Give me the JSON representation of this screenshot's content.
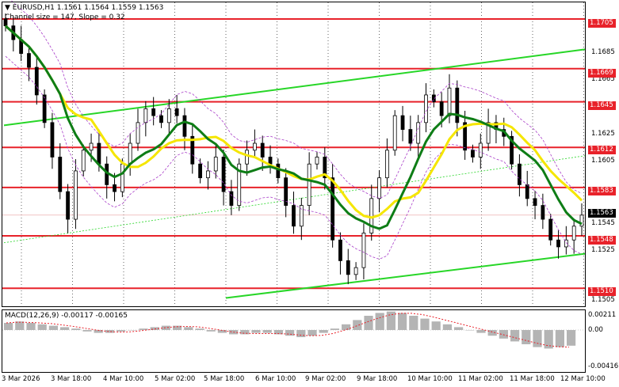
{
  "chart_header": {
    "symbol_info": "EURUSD,H1  1.1561 1.1564 1.1559 1.1563",
    "channel_info": "Channel size = 147, Slope = 0.32"
  },
  "price_levels": [
    {
      "label": "1.1705",
      "price": 1.1705
    },
    {
      "label": "1.1669",
      "price": 1.1669
    },
    {
      "label": "1.1645",
      "price": 1.1645
    },
    {
      "label": "1.1612",
      "price": 1.1612
    },
    {
      "label": "1.1583",
      "price": 1.1583
    },
    {
      "label": "1.1548",
      "price": 1.1548
    },
    {
      "label": "1.1510",
      "price": 1.151
    }
  ],
  "current_price": {
    "label": "1.1563",
    "price": 1.1563
  },
  "price_axis_ticks": [
    "1.1685",
    "1.1665",
    "1.1625",
    "1.1605",
    "1.1545",
    "1.1525",
    "1.1505"
  ],
  "time_axis": [
    "3 Mar 2026",
    "3 Mar 18:00",
    "4 Mar 10:00",
    "5 Mar 02:00",
    "5 Mar 18:00",
    "6 Mar 10:00",
    "9 Mar 02:00",
    "9 Mar 18:00",
    "10 Mar 10:00",
    "11 Mar 02:00",
    "11 Mar 18:00",
    "12 Mar 10:00"
  ],
  "macd": {
    "title": "MACD(12,26,9) -0.00117 -0.00165",
    "axis_ticks": [
      "0.00211",
      "0.00",
      "-0.00416"
    ]
  },
  "colors": {
    "level_line": "#e8222a",
    "ma_fast": "#f5e600",
    "ma_slow": "#0e7d16",
    "channel": "#27d627",
    "envelope": "#a93ec9",
    "candle": "#000000",
    "macd_hist": "#b4b4b4",
    "macd_signal": "#e8222a"
  },
  "chart_data": {
    "type": "candlestick",
    "symbol": "EURUSD",
    "timeframe": "H1",
    "ohlc_last": {
      "open": 1.1561,
      "high": 1.1564,
      "low": 1.1559,
      "close": 1.1563
    },
    "horizontal_levels": [
      1.1705,
      1.1669,
      1.1645,
      1.1612,
      1.1583,
      1.1548,
      1.151
    ],
    "ylim": [
      1.15,
      1.172
    ],
    "close_profile": [
      1.17,
      1.169,
      1.168,
      1.167,
      1.165,
      1.163,
      1.1605,
      1.158,
      1.156,
      1.1595,
      1.161,
      1.1615,
      1.16,
      1.1585,
      1.158,
      1.16,
      1.1615,
      1.163,
      1.164,
      1.1635,
      1.163,
      1.164,
      1.1635,
      1.162,
      1.16,
      1.159,
      1.1595,
      1.1605,
      1.158,
      1.157,
      1.16,
      1.161,
      1.1615,
      1.1605,
      1.16,
      1.159,
      1.157,
      1.1555,
      1.157,
      1.16,
      1.1605,
      1.159,
      1.1545,
      1.153,
      1.152,
      1.1525,
      1.155,
      1.1575,
      1.159,
      1.161,
      1.1635,
      1.1625,
      1.1615,
      1.163,
      1.165,
      1.1645,
      1.1635,
      1.1655,
      1.163,
      1.161,
      1.1605,
      1.1615,
      1.163,
      1.1625,
      1.162,
      1.16,
      1.1585,
      1.1575,
      1.157,
      1.156,
      1.1545,
      1.154,
      1.1545,
      1.1555,
      1.1563
    ],
    "macd_histogram": [
      0.0005,
      0.0006,
      0.0005,
      0.0004,
      0.0003,
      0.0002,
      0.0001,
      -0.0001,
      -0.0002,
      -0.0002,
      -0.0001,
      0.0,
      0.0001,
      0.0002,
      0.0003,
      0.0003,
      0.0002,
      0.0001,
      -0.0001,
      -0.0002,
      -0.0003,
      -0.0003,
      -0.0002,
      -0.0002,
      -0.0003,
      -0.0004,
      -0.0005,
      -0.0004,
      -0.0002,
      0.0001,
      0.0004,
      0.0007,
      0.001,
      0.0012,
      0.0013,
      0.0012,
      0.001,
      0.0008,
      0.0006,
      0.0004,
      0.0002,
      0.0,
      -0.0002,
      -0.0004,
      -0.0006,
      -0.0008,
      -0.001,
      -0.0012,
      -0.0013,
      -0.0012,
      -0.0011
    ],
    "macd_values": {
      "main": -0.00117,
      "signal": -0.00165
    }
  }
}
